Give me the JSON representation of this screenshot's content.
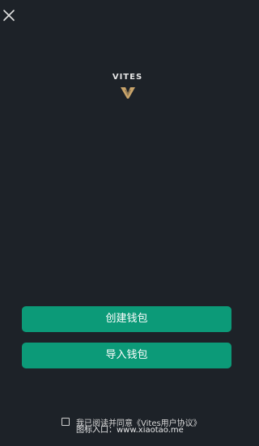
{
  "header": {
    "close_icon": "close-icon"
  },
  "brand": {
    "name": "VITES",
    "logo_icon": "vites-logo-icon",
    "logo_color": "#c9a46a"
  },
  "actions": {
    "create_wallet_label": "创建钱包",
    "import_wallet_label": "导入钱包",
    "button_color": "#0c9a78"
  },
  "agreement": {
    "prefix": "我已阅读并同意",
    "link_label": "《Vites用户协议》",
    "checked": false
  },
  "watermark": {
    "text": "图标入口：www.xiaotao.me"
  }
}
